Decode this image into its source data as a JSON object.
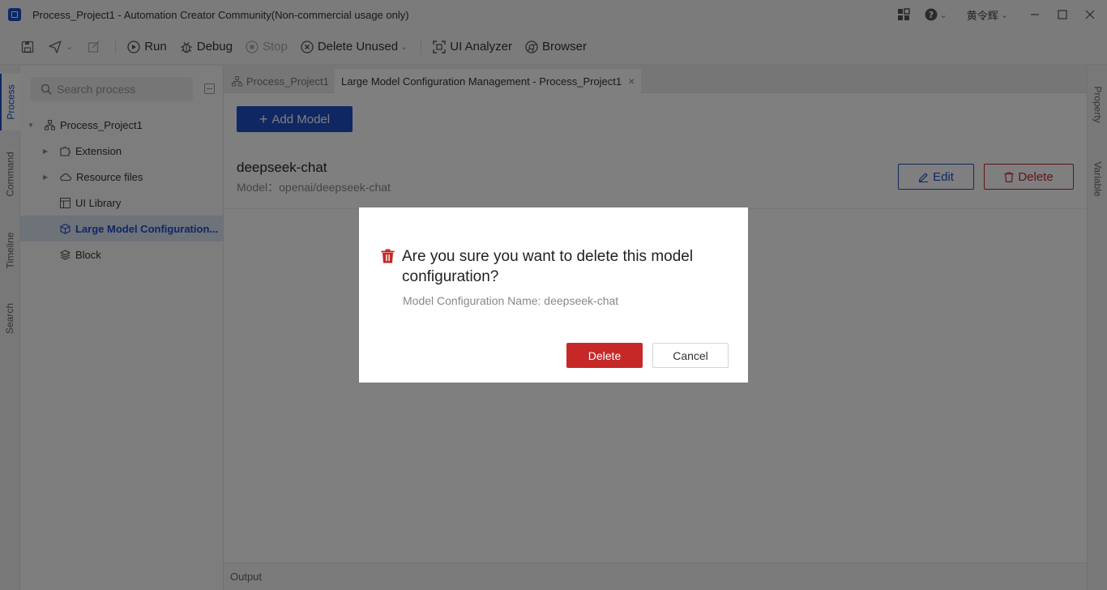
{
  "window": {
    "title": "Process_Project1 - Automation Creator Community(Non-commercial usage only)",
    "user": "黄令辉",
    "chevron": "⌄"
  },
  "toolbar": {
    "run": "Run",
    "debug": "Debug",
    "stop": "Stop",
    "delete_unused": "Delete Unused",
    "ui_analyzer": "UI Analyzer",
    "browser": "Browser"
  },
  "left_rail": {
    "tabs": [
      "Process",
      "Command",
      "Timeline",
      "Search"
    ]
  },
  "right_rail": {
    "tabs": [
      "Property",
      "Variable"
    ]
  },
  "sidebar": {
    "search_placeholder": "Search process",
    "tree": [
      {
        "label": "Process_Project1",
        "icon": "hierarchy-icon"
      },
      {
        "label": "Extension",
        "icon": "puzzle-icon"
      },
      {
        "label": "Resource files",
        "icon": "cloud-icon"
      },
      {
        "label": "UI Library",
        "icon": "layout-icon"
      },
      {
        "label": "Large Model Configuration...",
        "icon": "cube-icon",
        "selected": true
      },
      {
        "label": "Block",
        "icon": "layers-icon"
      }
    ]
  },
  "tabs": [
    {
      "label": "Process_Project1",
      "active": false
    },
    {
      "label": "Large Model Configuration Management - Process_Project1",
      "active": true
    }
  ],
  "main": {
    "add_model": "Add Model",
    "model": {
      "name": "deepseek-chat",
      "subtitle": "Model：openai/deepseek-chat",
      "edit": "Edit",
      "delete": "Delete"
    },
    "output": "Output"
  },
  "dialog": {
    "title": "Are you sure you want to delete this model configuration?",
    "message": "Model Configuration Name: deepseek-chat",
    "confirm": "Delete",
    "cancel": "Cancel"
  },
  "colors": {
    "primary": "#1f4fc6",
    "danger": "#c62828"
  }
}
